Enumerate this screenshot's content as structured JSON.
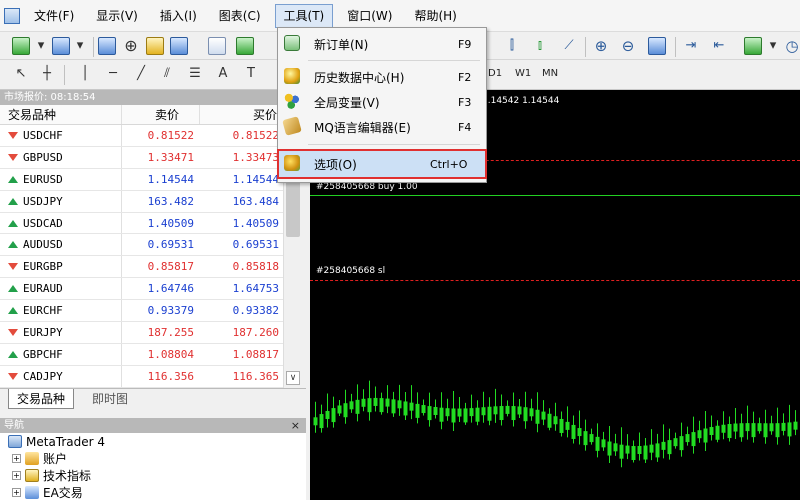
{
  "menubar": {
    "items": [
      "文件(F)",
      "显示(V)",
      "插入(I)",
      "图表(C)",
      "工具(T)",
      "窗口(W)",
      "帮助(H)"
    ],
    "active_index": 4
  },
  "toolbar": {
    "timeframes": [
      "D1",
      "W1",
      "MN"
    ],
    "new_order_fragment": "新",
    "text_tool": "A"
  },
  "tools_menu": {
    "items": [
      {
        "label": "新订单(N)",
        "shortcut": "F9",
        "icon": "new-order-icon"
      },
      {
        "label": "历史数据中心(H)",
        "shortcut": "F2",
        "icon": "history-center-icon"
      },
      {
        "label": "全局变量(V)",
        "shortcut": "F3",
        "icon": "global-variables-icon"
      },
      {
        "label": "MQ语言编辑器(E)",
        "shortcut": "F4",
        "icon": "metaeditor-icon"
      },
      {
        "label": "选项(O)",
        "shortcut": "Ctrl+O",
        "icon": "options-icon",
        "highlighted": true
      }
    ]
  },
  "market_watch": {
    "title": "市场报价: 08:18:54",
    "columns": [
      "交易品种",
      "卖价",
      "买价"
    ],
    "rows": [
      {
        "symbol": "USDCHF",
        "bid": "0.81522",
        "ask": "0.81522",
        "dir": "down",
        "color": "#e03030"
      },
      {
        "symbol": "GBPUSD",
        "bid": "1.33471",
        "ask": "1.33473",
        "dir": "down",
        "color": "#e03030"
      },
      {
        "symbol": "EURUSD",
        "bid": "1.14544",
        "ask": "1.14544",
        "dir": "up",
        "color": "#1a3fd0"
      },
      {
        "symbol": "USDJPY",
        "bid": "163.482",
        "ask": "163.484",
        "dir": "up",
        "color": "#1a3fd0"
      },
      {
        "symbol": "USDCAD",
        "bid": "1.40509",
        "ask": "1.40509",
        "dir": "up",
        "color": "#1a3fd0"
      },
      {
        "symbol": "AUDUSD",
        "bid": "0.69531",
        "ask": "0.69531",
        "dir": "up",
        "color": "#1a3fd0"
      },
      {
        "symbol": "EURGBP",
        "bid": "0.85817",
        "ask": "0.85818",
        "dir": "down",
        "color": "#e03030"
      },
      {
        "symbol": "EURAUD",
        "bid": "1.64746",
        "ask": "1.64753",
        "dir": "up",
        "color": "#1a3fd0"
      },
      {
        "symbol": "EURCHF",
        "bid": "0.93379",
        "ask": "0.93382",
        "dir": "up",
        "color": "#1a3fd0"
      },
      {
        "symbol": "EURJPY",
        "bid": "187.255",
        "ask": "187.260",
        "dir": "down",
        "color": "#e03030"
      },
      {
        "symbol": "GBPCHF",
        "bid": "1.08804",
        "ask": "1.08817",
        "dir": "up",
        "color": "#e03030"
      },
      {
        "symbol": "CADJPY",
        "bid": "116.356",
        "ask": "116.365",
        "dir": "down",
        "color": "#e03030"
      }
    ],
    "tabs": [
      "交易品种",
      "即时图"
    ]
  },
  "navigator": {
    "title": "导航",
    "root": "MetaTrader 4",
    "items": [
      "账户",
      "技术指标",
      "EA交易"
    ]
  },
  "chart": {
    "ohlc_text": "1.14542 1.14544",
    "orders": [
      {
        "label": "#258405668 buy 1.00",
        "color": "#22d022",
        "style": "solid"
      },
      {
        "label": "#258405668 sl",
        "color": "#e02020",
        "style": "dashed"
      }
    ],
    "extra_line_color": "#e02020"
  },
  "colors": {
    "bid_up": "#1a3fd0",
    "bid_down": "#e03030",
    "candle_up": "#22dd22",
    "highlight_border": "#e03030"
  }
}
